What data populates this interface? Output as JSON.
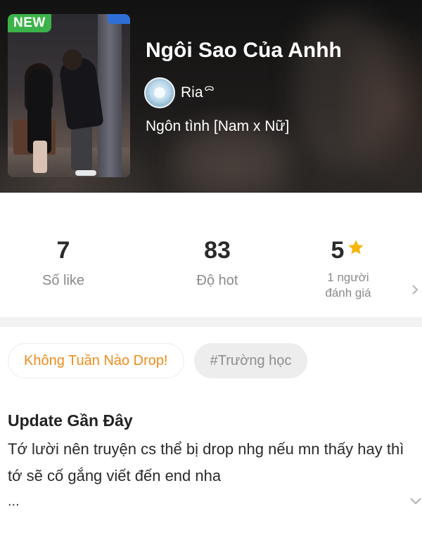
{
  "header": {
    "badge": "NEW",
    "title": "Ngôi Sao Của Anhh",
    "author": {
      "name": "Ria",
      "mark": "ᯅ",
      "avatar_icon": "avatar"
    },
    "genre": "Ngôn tình [Nam x Nữ]"
  },
  "stats": {
    "likes": {
      "value": "7",
      "label": "Số like"
    },
    "hot": {
      "value": "83",
      "label": "Độ hot"
    },
    "rating": {
      "value": "5",
      "label_line1": "1 người",
      "label_line2": "đánh giá",
      "icon": "star-icon"
    }
  },
  "tags": [
    {
      "label": "Không Tuần Nào Drop!"
    },
    {
      "label": "#Trường học"
    }
  ],
  "update": {
    "title": "Update Gần Đây",
    "text": "Tớ lười nên truyện cs thể bị drop nhg nếu mn thấy hay thì tớ sẽ cố gắng viết đến end nha",
    "more": "..."
  },
  "colors": {
    "badge_green": "#3bb34a",
    "tag_orange": "#ef8c1c",
    "star_yellow": "#f5b50a"
  }
}
